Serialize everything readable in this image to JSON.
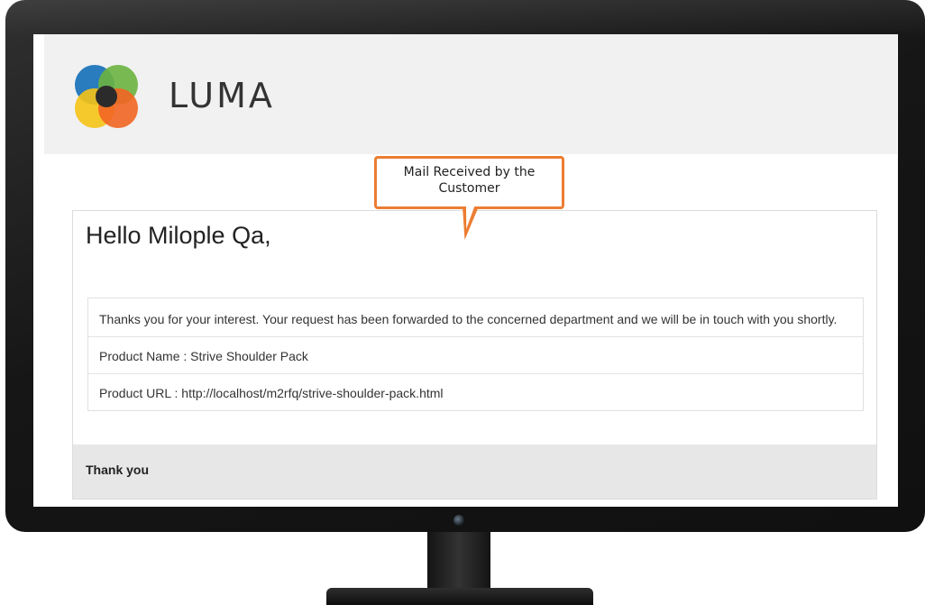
{
  "brand": {
    "name": "LUMA"
  },
  "callout": {
    "line1": "Mail Received by the",
    "line2": "Customer"
  },
  "email": {
    "greeting": "Hello Milople Qa,",
    "message": "Thanks you for your interest. Your request has been forwarded to the concerned department and we will be in touch with you shortly.",
    "product_name": "Product Name : Strive Shoulder Pack",
    "product_url": "Product URL : http://localhost/m2rfq/strive-shoulder-pack.html",
    "footer": "Thank you"
  },
  "colors": {
    "callout_border": "#ec7d32",
    "header_bg": "#f1f1f1",
    "footer_bg": "#e7e7e7",
    "logo_blue": "#1e75bb",
    "logo_green": "#6cb33f",
    "logo_yellow": "#f5c316",
    "logo_orange": "#f26522"
  },
  "icons": {
    "logo": "luma-logo-icon",
    "webcam": "webcam-icon"
  }
}
